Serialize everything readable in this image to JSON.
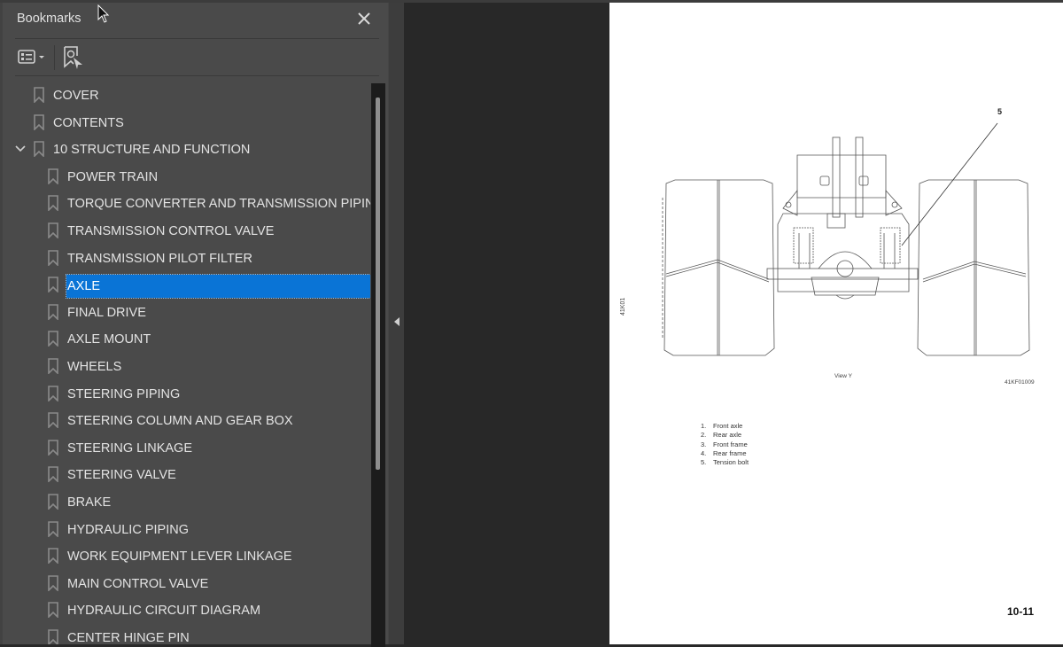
{
  "panel": {
    "title": "Bookmarks",
    "close_icon": "close-icon",
    "toolbar": {
      "options_icon": "list-options-icon",
      "options_dropdown_icon": "caret-down-icon",
      "find_bookmark_icon": "find-current-bookmark-icon"
    }
  },
  "bookmarks": [
    {
      "label": "COVER",
      "level": 0,
      "expandable": false,
      "selected": false
    },
    {
      "label": "CONTENTS",
      "level": 0,
      "expandable": false,
      "selected": false
    },
    {
      "label": "10 STRUCTURE AND FUNCTION",
      "level": 0,
      "expandable": true,
      "expanded": true,
      "selected": false
    },
    {
      "label": "POWER TRAIN",
      "level": 1,
      "selected": false
    },
    {
      "label": "TORQUE CONVERTER AND TRANSMISSION PIPING",
      "level": 1,
      "selected": false
    },
    {
      "label": "TRANSMISSION CONTROL VALVE",
      "level": 1,
      "selected": false
    },
    {
      "label": "TRANSMISSION PILOT FILTER",
      "level": 1,
      "selected": false
    },
    {
      "label": "AXLE",
      "level": 1,
      "selected": true
    },
    {
      "label": "FINAL DRIVE",
      "level": 1,
      "selected": false
    },
    {
      "label": "AXLE MOUNT",
      "level": 1,
      "selected": false
    },
    {
      "label": "WHEELS",
      "level": 1,
      "selected": false
    },
    {
      "label": "STEERING PIPING",
      "level": 1,
      "selected": false
    },
    {
      "label": "STEERING COLUMN AND GEAR BOX",
      "level": 1,
      "selected": false
    },
    {
      "label": "STEERING LINKAGE",
      "level": 1,
      "selected": false
    },
    {
      "label": "STEERING VALVE",
      "level": 1,
      "selected": false
    },
    {
      "label": "BRAKE",
      "level": 1,
      "selected": false
    },
    {
      "label": "HYDRAULIC PIPING",
      "level": 1,
      "selected": false
    },
    {
      "label": "WORK EQUIPMENT LEVER LINKAGE",
      "level": 1,
      "selected": false
    },
    {
      "label": "MAIN CONTROL VALVE",
      "level": 1,
      "selected": false
    },
    {
      "label": "HYDRAULIC CIRCUIT DIAGRAM",
      "level": 1,
      "selected": false
    },
    {
      "label": "CENTER HINGE PIN",
      "level": 1,
      "selected": false
    }
  ],
  "scrollbar": {
    "thumb_start_fraction": 0.025,
    "thumb_visible_fraction": 0.66
  },
  "document_page": {
    "callout_number": "5",
    "side_code": "41K01",
    "view_label": "View Y",
    "figure_code": "41KF01009",
    "legend": [
      {
        "num": "1.",
        "text": "Front axle"
      },
      {
        "num": "2.",
        "text": "Rear axle"
      },
      {
        "num": "3.",
        "text": "Front frame"
      },
      {
        "num": "4.",
        "text": "Rear frame"
      },
      {
        "num": "5.",
        "text": "Tension bolt"
      }
    ],
    "page_number": "10-11"
  },
  "colors": {
    "selection": "#0a74d6",
    "panel_bg": "#4a4a4a",
    "viewer_bg": "#282828"
  }
}
